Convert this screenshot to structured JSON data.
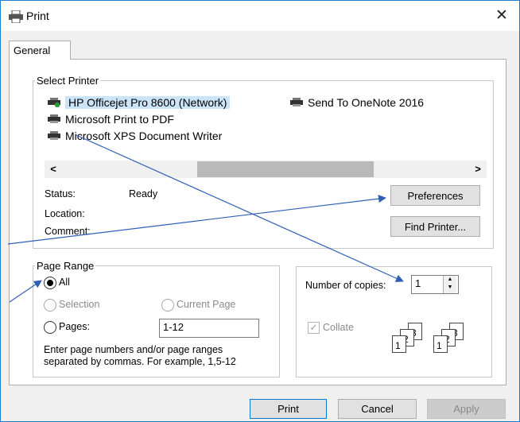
{
  "window": {
    "title": "Print",
    "close_glyph": "✕"
  },
  "tabs": [
    {
      "label": "General"
    }
  ],
  "select_printer": {
    "legend": "Select Printer",
    "printers": [
      {
        "name": "HP Officejet Pro 8600 (Network)",
        "selected": true,
        "icon": "network-printer-icon"
      },
      {
        "name": "Send To OneNote 2016",
        "selected": false,
        "icon": "printer-icon"
      },
      {
        "name": "Microsoft Print to PDF",
        "selected": false,
        "icon": "printer-icon"
      },
      {
        "name": "Microsoft XPS Document Writer",
        "selected": false,
        "icon": "printer-icon"
      }
    ],
    "scroll_left": "<",
    "scroll_right": ">",
    "status_label": "Status:",
    "status_value": "Ready",
    "location_label": "Location:",
    "comment_label": "Comment:",
    "preferences_button": "Preferences",
    "find_printer_button": "Find Printer..."
  },
  "page_range": {
    "legend": "Page Range",
    "all_label": "All",
    "selection_label": "Selection",
    "current_page_label": "Current Page",
    "pages_label": "Pages:",
    "pages_value": "1-12",
    "hint_line1": "Enter page numbers and/or page ranges",
    "hint_line2": "separated by commas.  For example, 1,5-12",
    "selected_option": "All"
  },
  "copies": {
    "number_label": "Number of copies:",
    "number_value": "1",
    "collate_label": "Collate",
    "collate_checked": true
  },
  "footer": {
    "print_button": "Print",
    "cancel_button": "Cancel",
    "apply_button": "Apply"
  },
  "colors": {
    "accent": "#0078d7",
    "selection": "#cce4f7",
    "arrow": "#2f5fb5"
  }
}
